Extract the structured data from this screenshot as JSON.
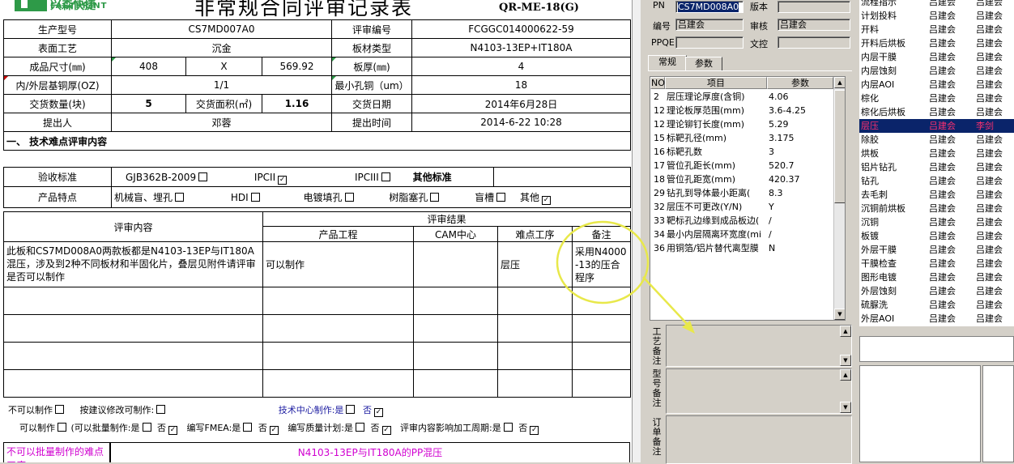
{
  "header": {
    "logo_cn": "兴森快捷",
    "logo_en": "FASTPRINT",
    "title": "非常规合同评审记录表",
    "form_code": "QR-ME-18(G)"
  },
  "form": {
    "prod_model_label": "生产型号",
    "prod_model": "CS7MD007A0",
    "review_no_label": "评审编号",
    "review_no": "FCGGC014000622-59",
    "surface_label": "表面工艺",
    "surface": "沉金",
    "board_type_label": "板材类型",
    "board_type": "N4103-13EP+IT180A",
    "size_label": "成品尺寸(㎜)",
    "size_w": "408",
    "size_x": "X",
    "size_h": "569.92",
    "thickness_label": "板厚(㎜)",
    "thickness": "4",
    "copper_label": "内/外层基铜厚(OZ)",
    "copper": "1/1",
    "min_hole_label": "最小孔铜（um）",
    "min_hole": "18",
    "qty_label": "交货数量(块)",
    "qty": "5",
    "area_label": "交货面积(㎡)",
    "area": "1.16",
    "date_label": "交货日期",
    "date": "2014年6月28日",
    "submitter_label": "提出人",
    "submitter": "邓蓉",
    "submit_time_label": "提出时间",
    "submit_time": "2014-6-22 10:28",
    "section_title": "一、 技术难点评审内容",
    "accept_label": "验收标准",
    "std1": "GJB362B-2009",
    "std2": "IPCII",
    "std3": "IPCIII",
    "other_std_label": "其他标准",
    "feature_label": "产品特点",
    "feat1": "机械盲、埋孔",
    "feat2": "HDI",
    "feat3": "电镀填孔",
    "feat4": "树脂塞孔",
    "feat5": "盲槽",
    "feat6": "其他"
  },
  "review": {
    "content_header": "评审内容",
    "result_header": "评审结果",
    "col_eng": "产品工程",
    "col_cam": "CAM中心",
    "col_step": "难点工序",
    "col_note": "备注",
    "content": "此板和CS7MD008A0两款板都是N4103-13EP与IT180A混压，涉及到2种不同板材和半固化片，叠层见附件请评审是否可以制作",
    "eng": "可以制作",
    "step": "层压",
    "note": "采用N4000-13的压合程序"
  },
  "options": {
    "o1": "不可以制作",
    "o2": "按建议修改可制作:",
    "o3": "技术中心制作:是",
    "o3b": "否",
    "p1": "可以制作",
    "p2": "(可以批量制作:是",
    "p2b": "否",
    "p3": "编写FMEA:是",
    "p3b": "否",
    "p4": "编写质量计划:是",
    "p4b": "否",
    "p5": "评审内容影响加工周期:是",
    "p5b": "否"
  },
  "footer": {
    "left": "不可以批量制作的难点工序",
    "right": "N4103-13EP与IT180A的PP混压"
  },
  "panel": {
    "pn_label": "PN",
    "pn": "CS7MD008A0",
    "ver_label": "版本",
    "ver": "",
    "code_label": "编号",
    "code": "吕建会",
    "audit_label": "审核",
    "audit": "吕建会",
    "ppqe_label": "PPQE",
    "ppqe": "",
    "doc_label": "文控",
    "doc": "",
    "tab_general": "常规",
    "tab_param": "参数",
    "col_no": "NO",
    "col_item": "项目",
    "col_param": "参数",
    "params": [
      {
        "no": "2",
        "item": "层压理论厚度(含铜)",
        "val": "4.06"
      },
      {
        "no": "12",
        "item": "理论板厚范围(mm)",
        "val": "3.6-4.25"
      },
      {
        "no": "12",
        "item": "理论铆钉长度(mm)",
        "val": "5.29"
      },
      {
        "no": "15",
        "item": "标靶孔径(mm)",
        "val": "3.175"
      },
      {
        "no": "16",
        "item": "标靶孔数",
        "val": "3"
      },
      {
        "no": "17",
        "item": "管位孔距长(mm)",
        "val": "520.7"
      },
      {
        "no": "18",
        "item": "管位孔距宽(mm)",
        "val": "420.37"
      },
      {
        "no": "29",
        "item": "钻孔到导体最小距离(",
        "val": "8.3"
      },
      {
        "no": "32",
        "item": "层压不可更改(Y/N)",
        "val": "Y"
      },
      {
        "no": "33",
        "item": "靶标孔边缘到成品板边(",
        "val": "/"
      },
      {
        "no": "34",
        "item": "最小内层隔离环宽度(mi",
        "val": "/"
      },
      {
        "no": "36",
        "item": "用铜箔/铝片替代离型膜",
        "val": "N"
      }
    ],
    "memo1": "工艺备注",
    "memo2": "型号备注",
    "memo3": "订单备注"
  },
  "steps": [
    {
      "name": "流程指示",
      "a": "吕建会",
      "b": "吕建会"
    },
    {
      "name": "计划投料",
      "a": "吕建会",
      "b": "吕建会"
    },
    {
      "name": "开料",
      "a": "吕建会",
      "b": "吕建会"
    },
    {
      "name": "开料后烘板",
      "a": "吕建会",
      "b": "吕建会"
    },
    {
      "name": "内层干膜",
      "a": "吕建会",
      "b": "吕建会"
    },
    {
      "name": "内层蚀刻",
      "a": "吕建会",
      "b": "吕建会"
    },
    {
      "name": "内层AOI",
      "a": "吕建会",
      "b": "吕建会"
    },
    {
      "name": "棕化",
      "a": "吕建会",
      "b": "吕建会"
    },
    {
      "name": "棕化后烘板",
      "a": "吕建会",
      "b": "吕建会"
    },
    {
      "name": "层压",
      "a": "吕建会",
      "b": "李剑"
    },
    {
      "name": "除胶",
      "a": "吕建会",
      "b": "吕建会"
    },
    {
      "name": "烘板",
      "a": "吕建会",
      "b": "吕建会"
    },
    {
      "name": "铝片钻孔",
      "a": "吕建会",
      "b": "吕建会"
    },
    {
      "name": "钻孔",
      "a": "吕建会",
      "b": "吕建会"
    },
    {
      "name": "去毛刺",
      "a": "吕建会",
      "b": "吕建会"
    },
    {
      "name": "沉铜前烘板",
      "a": "吕建会",
      "b": "吕建会"
    },
    {
      "name": "沉铜",
      "a": "吕建会",
      "b": "吕建会"
    },
    {
      "name": "板镀",
      "a": "吕建会",
      "b": "吕建会"
    },
    {
      "name": "外层干膜",
      "a": "吕建会",
      "b": "吕建会"
    },
    {
      "name": "干膜检查",
      "a": "吕建会",
      "b": "吕建会"
    },
    {
      "name": "图形电镀",
      "a": "吕建会",
      "b": "吕建会"
    },
    {
      "name": "外层蚀刻",
      "a": "吕建会",
      "b": "吕建会"
    },
    {
      "name": "硫脲洗",
      "a": "吕建会",
      "b": "吕建会"
    },
    {
      "name": "外层AOI",
      "a": "吕建会",
      "b": "吕建会"
    }
  ]
}
